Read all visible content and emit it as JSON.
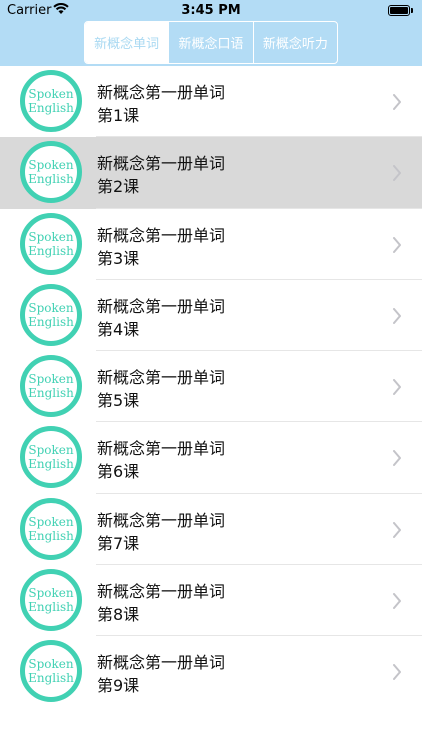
{
  "status_bar": {
    "carrier": "Carrier",
    "time": "3:45 PM",
    "battery_level": 1.0
  },
  "tabs": [
    {
      "label": "新概念单词",
      "active": true
    },
    {
      "label": "新概念口语",
      "active": false
    },
    {
      "label": "新概念听力",
      "active": false
    }
  ],
  "colors": {
    "header": "#b3dcf5",
    "logo_accent": "#41d1b3",
    "selected_row": "#d9d9d9"
  },
  "list": {
    "items": [
      {
        "title": "新概念第一册单词",
        "lesson": "第1课",
        "logo_line1": "Spoken",
        "logo_line2": "English",
        "selected": false
      },
      {
        "title": "新概念第一册单词",
        "lesson": "第2课",
        "logo_line1": "Spoken",
        "logo_line2": "English",
        "selected": true
      },
      {
        "title": "新概念第一册单词",
        "lesson": "第3课",
        "logo_line1": "Spoken",
        "logo_line2": "English",
        "selected": false
      },
      {
        "title": "新概念第一册单词",
        "lesson": "第4课",
        "logo_line1": "Spoken",
        "logo_line2": "English",
        "selected": false
      },
      {
        "title": "新概念第一册单词",
        "lesson": "第5课",
        "logo_line1": "Spoken",
        "logo_line2": "English",
        "selected": false
      },
      {
        "title": "新概念第一册单词",
        "lesson": "第6课",
        "logo_line1": "Spoken",
        "logo_line2": "English",
        "selected": false
      },
      {
        "title": "新概念第一册单词",
        "lesson": "第7课",
        "logo_line1": "Spoken",
        "logo_line2": "English",
        "selected": false
      },
      {
        "title": "新概念第一册单词",
        "lesson": "第8课",
        "logo_line1": "Spoken",
        "logo_line2": "English",
        "selected": false
      },
      {
        "title": "新概念第一册单词",
        "lesson": "第9课",
        "logo_line1": "Spoken",
        "logo_line2": "English",
        "selected": false
      }
    ]
  }
}
